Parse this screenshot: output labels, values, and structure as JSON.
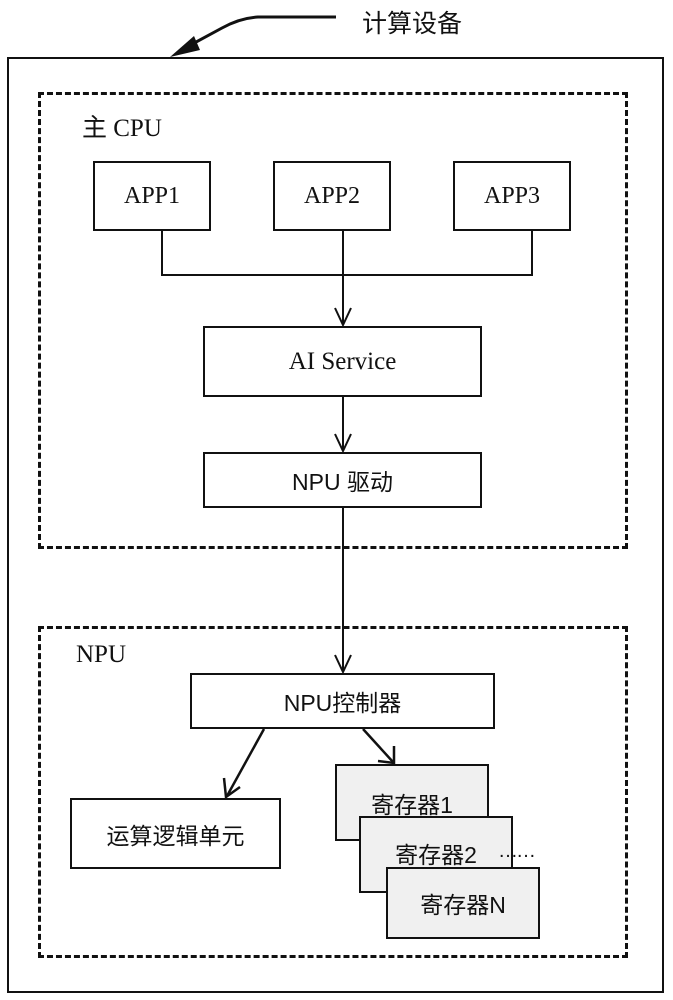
{
  "title": "计算设备",
  "host_cpu": {
    "label": "主 CPU",
    "apps": [
      "APP1",
      "APP2",
      "APP3"
    ],
    "ai_service": "AI Service",
    "npu_driver": "NPU 驱动"
  },
  "npu": {
    "label": "NPU",
    "controller": "NPU控制器",
    "alu": "运算逻辑单元",
    "registers": [
      "寄存器1",
      "寄存器2",
      "寄存器N"
    ],
    "ellipsis": "……"
  },
  "colors": {
    "line": "#111111",
    "register_fill": "#f0f0f0",
    "background": "#ffffff"
  }
}
